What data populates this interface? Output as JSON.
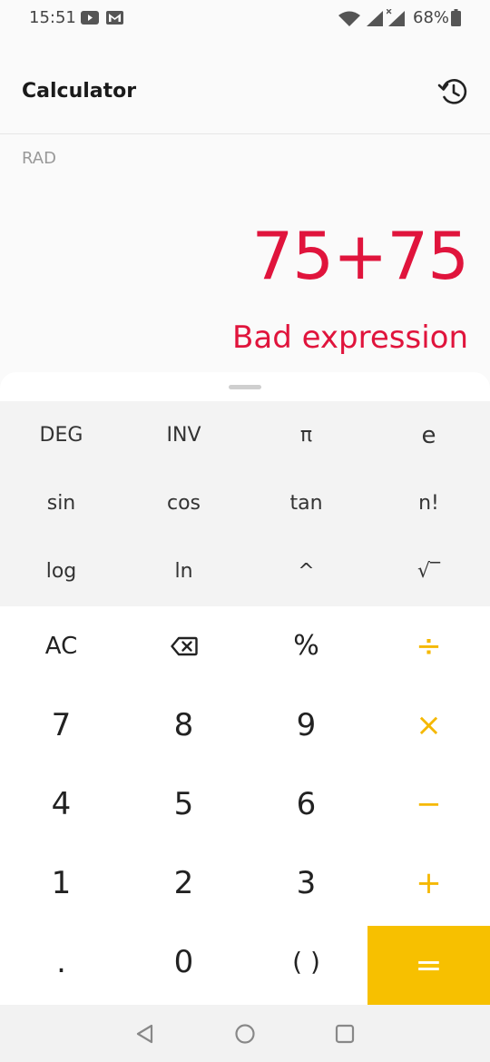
{
  "status_bar": {
    "time": "15:51",
    "battery": "68%",
    "icons": [
      "youtube-icon",
      "gmail-icon",
      "wifi-icon",
      "signal-icon",
      "signal-x-icon",
      "battery-icon"
    ]
  },
  "app_bar": {
    "title": "Calculator",
    "history_icon": "history-icon"
  },
  "display": {
    "angle_mode": "RAD",
    "expression": "75+75",
    "result": "Bad expression"
  },
  "scientific_keys": {
    "row1": [
      "DEG",
      "INV",
      "π",
      "e"
    ],
    "row2": [
      "sin",
      "cos",
      "tan",
      "n!"
    ],
    "row3": [
      "log",
      "ln",
      "^",
      "√‾"
    ]
  },
  "keys": {
    "row1": [
      "AC",
      "",
      "%",
      "÷"
    ],
    "row2": [
      "7",
      "8",
      "9",
      "×"
    ],
    "row3": [
      "4",
      "5",
      "6",
      "−"
    ],
    "row4": [
      "1",
      "2",
      "3",
      "+"
    ],
    "row5": [
      ".",
      "0",
      "( )",
      "="
    ]
  },
  "colors": {
    "accent": "#f7c000",
    "error": "#e0143c"
  },
  "nav_bar": {
    "icons": [
      "back-icon",
      "home-icon",
      "recents-icon"
    ]
  }
}
